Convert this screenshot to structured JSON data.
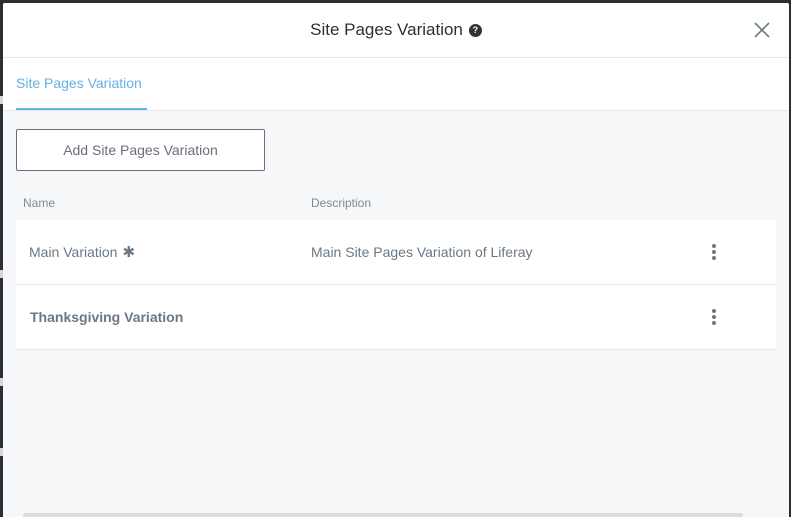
{
  "modal": {
    "title": "Site Pages Variation",
    "help_icon": "?",
    "close_icon": "close-icon"
  },
  "tabs": [
    {
      "label": "Site Pages Variation",
      "active": true
    }
  ],
  "actions": {
    "add_label": "Add Site Pages Variation"
  },
  "table": {
    "columns": [
      "Name",
      "Description"
    ],
    "rows": [
      {
        "name": "Main Variation",
        "marker": "✱",
        "description": "Main Site Pages Variation of Liferay"
      },
      {
        "name": "Thanksgiving Variation",
        "marker": "",
        "description": ""
      }
    ]
  },
  "colors": {
    "accent": "#65b0e6",
    "text": "#6b7883",
    "title": "#2b3136"
  }
}
